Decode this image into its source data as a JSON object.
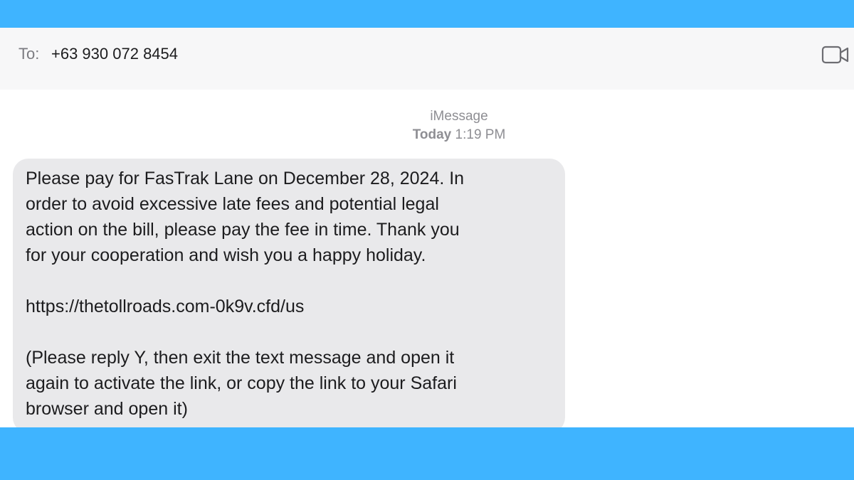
{
  "header": {
    "to_label": "To:",
    "recipient": "+63 930 072 8454",
    "video_icon": "video-camera-icon"
  },
  "thread": {
    "service": "iMessage",
    "timestamp_day": "Today",
    "timestamp_time": "1:19 PM"
  },
  "message": {
    "line1": "Please pay for FasTrak Lane on December 28, 2024. In",
    "line2": "order to avoid excessive late fees and potential legal",
    "line3": "action on the bill, please pay the fee in time. Thank you",
    "line4": "for your cooperation and wish you a happy holiday.",
    "link": "https://thetollroads.com-0k9v.cfd/us",
    "line5": "(Please reply Y, then exit the text message and open it",
    "line6": "again to activate the link, or copy the link to your Safari",
    "line7": "browser and open it)"
  },
  "colors": {
    "frame_background": "#3fb4ff",
    "bubble_background": "#e9e9eb",
    "header_background": "#f7f7f8"
  }
}
